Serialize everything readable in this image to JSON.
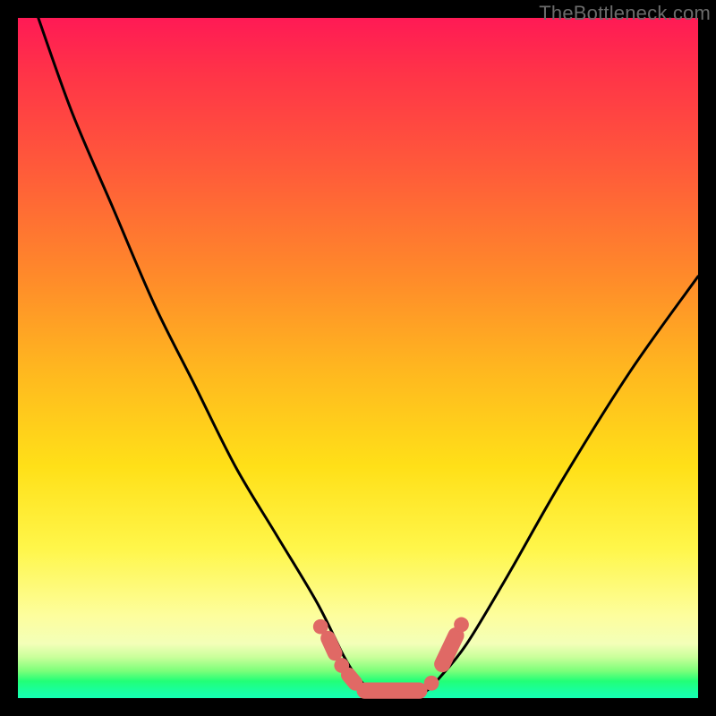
{
  "watermark": {
    "text": "TheBottleneck.com"
  },
  "colors": {
    "curve_stroke": "#000000",
    "marker_fill": "#e06965",
    "gradient_top": "#ff1a55",
    "gradient_bottom": "#15ffb4",
    "background": "#000000"
  },
  "chart_data": {
    "type": "line",
    "title": "",
    "xlabel": "",
    "ylabel": "",
    "xlim": [
      0,
      100
    ],
    "ylim": [
      0,
      100
    ],
    "grid": false,
    "legend": false,
    "note": "V-shaped curve over a vertical red→green gradient. No axis ticks or labels are rendered; values below are estimated in 0–100 normalized coordinates from geometry alone.",
    "series": [
      {
        "name": "bottleneck-curve",
        "stroke": "#000000",
        "x": [
          3,
          8,
          14,
          20,
          26,
          32,
          38,
          44,
          48,
          50,
          52,
          54,
          56,
          58,
          60,
          62,
          66,
          72,
          80,
          90,
          100
        ],
        "y": [
          100,
          86,
          72,
          58,
          46,
          34,
          24,
          14,
          6,
          3,
          1,
          0,
          0,
          0,
          1,
          3,
          8,
          18,
          32,
          48,
          62
        ]
      }
    ],
    "markers": [
      {
        "shape": "dot",
        "x": 44.5,
        "y": 10.5,
        "r": 1.1
      },
      {
        "shape": "capsule",
        "x1": 45.6,
        "y1": 8.8,
        "x2": 46.6,
        "y2": 6.6,
        "w": 2.2
      },
      {
        "shape": "dot",
        "x": 47.6,
        "y": 4.8,
        "r": 1.1
      },
      {
        "shape": "capsule",
        "x1": 48.6,
        "y1": 3.4,
        "x2": 49.6,
        "y2": 2.2,
        "w": 2.2
      },
      {
        "shape": "capsule",
        "x1": 51.0,
        "y1": 1.1,
        "x2": 59.0,
        "y2": 1.1,
        "w": 2.4
      },
      {
        "shape": "dot",
        "x": 60.8,
        "y": 2.2,
        "r": 1.1
      },
      {
        "shape": "capsule",
        "x1": 62.4,
        "y1": 5.0,
        "x2": 64.4,
        "y2": 9.2,
        "w": 2.4
      },
      {
        "shape": "dot",
        "x": 65.2,
        "y": 10.8,
        "r": 1.1
      }
    ]
  }
}
